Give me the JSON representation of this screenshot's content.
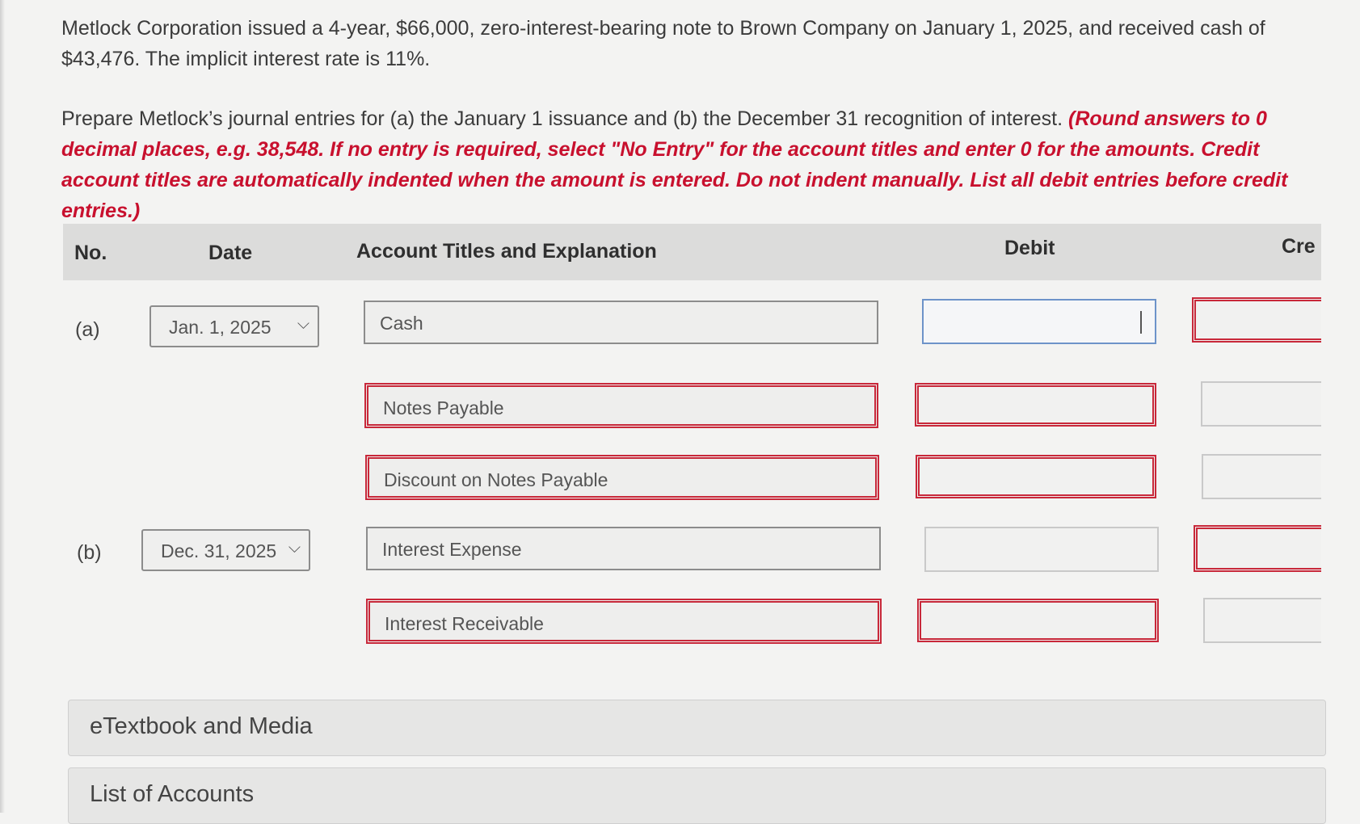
{
  "problem": {
    "text": "Metlock Corporation issued a 4-year, $66,000, zero-interest-bearing note to Brown Company on January 1, 2025, and received cash of $43,476. The implicit interest rate is 11%."
  },
  "instructions": {
    "text": "Prepare Metlock’s journal entries for (a) the January 1 issuance and (b) the December 31 recognition of interest.",
    "note": "(Round answers to 0 decimal places, e.g. 38,548. If no entry is required, select \"No Entry\" for the account titles and enter 0 for the amounts. Credit account titles are automatically indented when the amount is entered. Do not indent manually. List all debit entries before credit entries.)"
  },
  "table": {
    "headers": {
      "no": "No.",
      "date": "Date",
      "account": "Account Titles and Explanation",
      "debit": "Debit",
      "credit": "Cre"
    },
    "rows": [
      {
        "no": "(a)",
        "date": "Jan. 1, 2025",
        "account": "Cash",
        "debit": "",
        "credit": ""
      },
      {
        "no": "",
        "date": "",
        "account": "Notes Payable",
        "debit": "",
        "credit": ""
      },
      {
        "no": "",
        "date": "",
        "account": "Discount on Notes Payable",
        "debit": "",
        "credit": ""
      },
      {
        "no": "(b)",
        "date": "Dec. 31, 2025",
        "account": "Interest Expense",
        "debit": "",
        "credit": ""
      },
      {
        "no": "",
        "date": "",
        "account": "Interest Receivable",
        "debit": "",
        "credit": ""
      }
    ]
  },
  "panels": {
    "etextbook": "eTextbook and Media",
    "accounts": "List of Accounts"
  },
  "icons": {
    "dropdown": "chevron-down-icon"
  },
  "colors": {
    "error_border": "#c8283a",
    "active_border": "#6d93c9",
    "instruction_red": "#c8102e"
  }
}
